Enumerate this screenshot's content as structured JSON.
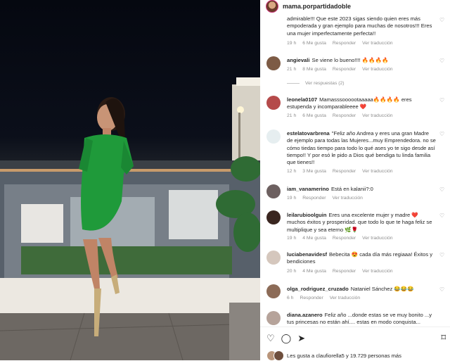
{
  "post": {
    "username": "mama.porpartidadoble"
  },
  "comments": [
    {
      "user": "",
      "text": "admirable!!! Que este 2023 sigas siendo quien eres más empoderada y gran ejemplo para muchas de nosotros!!! Eres una mujer imperfectamente perfecta!!",
      "time": "19 h",
      "likes": "6 Me gusta",
      "reply": "Responder",
      "translate": "Ver traducción"
    },
    {
      "user": "angievali",
      "text": "Se viene lo bueno!!!! 🔥🔥🔥🔥",
      "time": "21 h",
      "likes": "8 Me gusta",
      "reply": "Responder",
      "translate": "Ver traducción",
      "replies": "Ver respuestas (2)"
    },
    {
      "user": "leonela0107",
      "text": "Mamasssoooootaaaaa🔥🔥🔥🔥 eres estupenda y incomparableeee ❤️",
      "time": "21 h",
      "likes": "6 Me gusta",
      "reply": "Responder",
      "translate": "Ver traducción"
    },
    {
      "user": "estelatovarbrena",
      "text": "\"Feliz año Andrea y eres una gran Madre de ejemplo para todas las Mujeres...muy Emprendedora. no se cómo tiedas tiempo para todo lo qué ases yo te sigo desde así tiempo!! Y por esó le pido a Dios qué bendiga tu linda familia que tienes!!",
      "time": "12 h",
      "likes": "3 Me gusta",
      "reply": "Responder",
      "translate": "Ver traducción"
    },
    {
      "user": "iam_vanamerino",
      "text": "Está en kalanii?:0",
      "time": "19 h",
      "likes": "",
      "reply": "Responder",
      "translate": "Ver traducción"
    },
    {
      "user": "leilarubioolguin",
      "text": "Eres una excelente mujer y madre ❤️ muchos éxitos y prosperidad. que todo lo que te haga feliz se multiplique y sea eterno 🌿🌹",
      "time": "19 h",
      "likes": "4 Me gusta",
      "reply": "Responder",
      "translate": "Ver traducción"
    },
    {
      "user": "luciabenavidesf",
      "text": "Bebecita 😍 cada día más regiaaa! Éxitos y bendiciones",
      "time": "20 h",
      "likes": "4 Me gusta",
      "reply": "Responder",
      "translate": "Ver traducción"
    },
    {
      "user": "olga_rodriguez_cruzado",
      "text": "Nataniel Sánchez 😂😂😂",
      "time": "6 h",
      "likes": "",
      "reply": "Responder",
      "translate": "Ver traducción"
    },
    {
      "user": "diana.azanero",
      "text": "Feliz año ...donde estas se ve muy bonito ...y tus princesas no están ahí.... estas en modo conquista...",
      "time": "",
      "likes": "",
      "reply": "",
      "translate": ""
    }
  ],
  "footer": {
    "icons": {
      "like": "♡",
      "comment": "◯",
      "share": "➤",
      "save": "⌑"
    },
    "likes_text": "Les gusta a claufiorella5 y 19.729 personas más"
  },
  "colors": {
    "dress": "#1f9a3a",
    "accent_link": "#8e8e8e",
    "heart": "#ed4956"
  }
}
